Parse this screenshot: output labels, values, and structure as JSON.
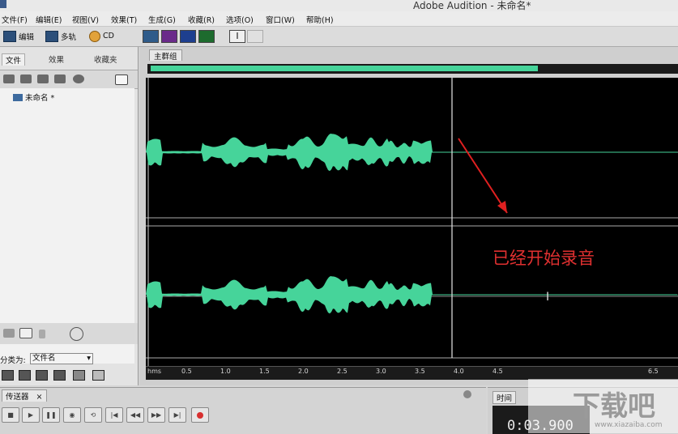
{
  "window": {
    "title": "Adobe Audition - 未命名*"
  },
  "menu": [
    "文件(F)",
    "编辑(E)",
    "视图(V)",
    "效果(T)",
    "生成(G)",
    "收藏(R)",
    "选项(O)",
    "窗口(W)",
    "帮助(H)"
  ],
  "toolbar": {
    "edit_label": "编辑",
    "multitrack_label": "多轨",
    "cd_label": "CD"
  },
  "left_panel": {
    "tabs": [
      "文件",
      "效果",
      "收藏夹"
    ],
    "file_item": "未命名 *",
    "sort_label": "分类为:",
    "sort_value": "文件名"
  },
  "editor": {
    "tab_label": "主群组",
    "annotation": "已经开始录音",
    "ruler_ticks": [
      "hms",
      "0.5",
      "1.0",
      "1.5",
      "2.0",
      "2.5",
      "3.0",
      "3.5",
      "4.0",
      "4.5",
      "",
      "",
      "",
      "",
      "6.5"
    ],
    "waveform_color": "#46d49a"
  },
  "transport": {
    "tab_label": "传送器",
    "record_color": "#d83030"
  },
  "time": {
    "tab_label": "时间",
    "value": "0:03.900"
  },
  "watermark": {
    "text": "下载吧",
    "sub": "www.xiazaiba.com"
  }
}
